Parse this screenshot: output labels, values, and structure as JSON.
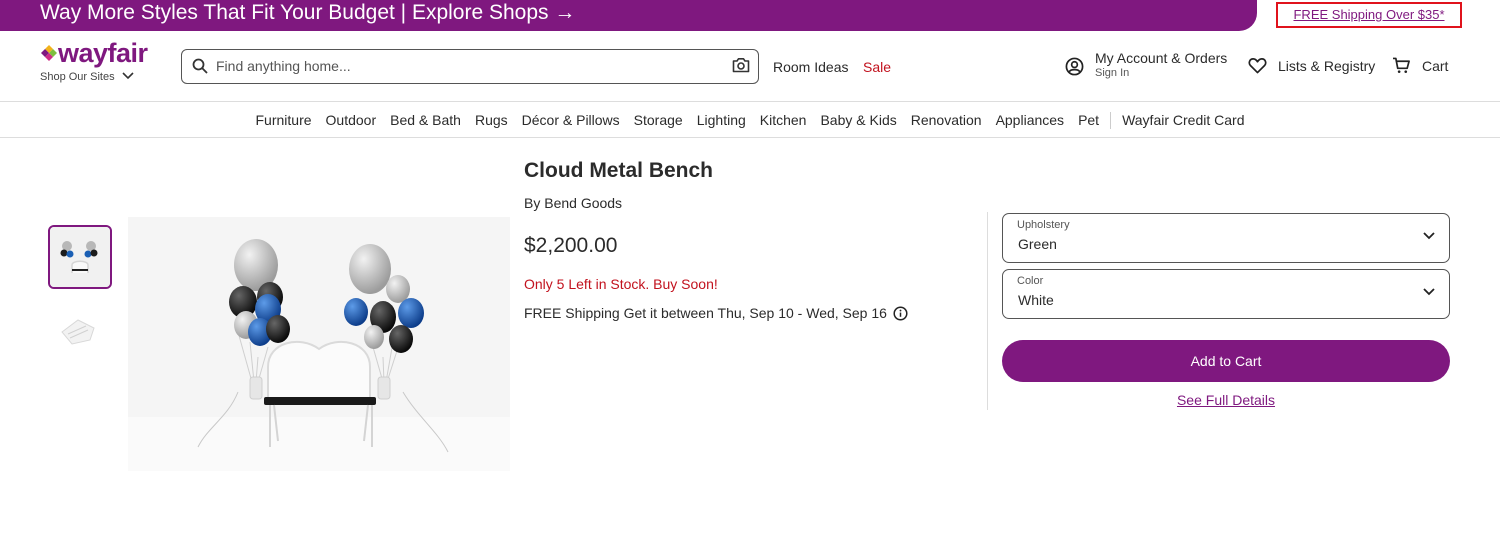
{
  "promo": {
    "banner_text": "Way More Styles That Fit Your Budget | Explore Shops →",
    "shipping_link": "FREE Shipping Over $35*"
  },
  "header": {
    "logo_text": "wayfair",
    "shop_sites": "Shop Our Sites",
    "search_placeholder": "Find anything home...",
    "room_ideas": "Room Ideas",
    "sale": "Sale",
    "account_main": "My Account & Orders",
    "account_sub": "Sign In",
    "lists": "Lists & Registry",
    "cart": "Cart"
  },
  "categories": [
    "Furniture",
    "Outdoor",
    "Bed & Bath",
    "Rugs",
    "Décor & Pillows",
    "Storage",
    "Lighting",
    "Kitchen",
    "Baby & Kids",
    "Renovation",
    "Appliances",
    "Pet"
  ],
  "credit_card": "Wayfair Credit Card",
  "product": {
    "title": "Cloud Metal Bench",
    "brand": "By Bend Goods",
    "price": "$2,200.00",
    "stock": "Only 5 Left in Stock. Buy Soon!",
    "shipping": "FREE Shipping Get it between Thu, Sep 10 - Wed, Sep 16"
  },
  "options": {
    "upholstery_label": "Upholstery",
    "upholstery_value": "Green",
    "color_label": "Color",
    "color_value": "White"
  },
  "actions": {
    "add_to_cart": "Add to Cart",
    "see_details": "See Full Details"
  },
  "colors": {
    "brand_purple": "#7f187f",
    "stock_red": "#c2121e"
  }
}
